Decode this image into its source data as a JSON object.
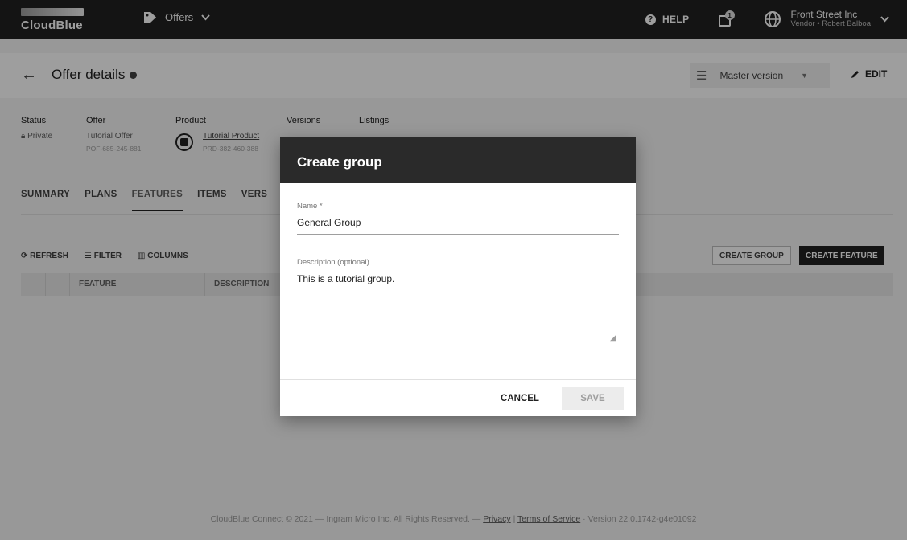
{
  "topbar": {
    "logo_text": "CloudBlue",
    "module_label": "Offers",
    "help_label": "HELP",
    "notif_count": "1",
    "account_name": "Front Street Inc",
    "account_sub": "Vendor • Robert Balboa"
  },
  "header": {
    "title": "Offer details",
    "version_label": "Master version",
    "edit_label": "EDIT"
  },
  "details": {
    "status": {
      "label": "Status",
      "value": "Private"
    },
    "offer": {
      "label": "Offer",
      "name": "Tutorial Offer",
      "id": "POF-685-245-881"
    },
    "product": {
      "label": "Product",
      "name": "Tutorial Product",
      "id": "PRD-382-460-388"
    },
    "versions": {
      "label": "Versions"
    },
    "listings": {
      "label": "Listings"
    }
  },
  "tabs": [
    "SUMMARY",
    "PLANS",
    "FEATURES",
    "ITEMS",
    "VERS"
  ],
  "toolbar": {
    "refresh": "REFRESH",
    "filter": "FILTER",
    "columns": "COLUMNS",
    "create_group": "CREATE GROUP",
    "create_feature": "CREATE FEATURE"
  },
  "table": {
    "columns": [
      "FEATURE",
      "DESCRIPTION"
    ]
  },
  "dialog": {
    "title": "Create group",
    "name_label": "Name *",
    "name_value": "General Group",
    "desc_label": "Description (optional)",
    "desc_value": "This is a tutorial group.",
    "cancel_label": "CANCEL",
    "save_label": "SAVE"
  },
  "footer": {
    "text_before": "CloudBlue Connect © 2021 — Ingram Micro Inc. All Rights Reserved. — ",
    "privacy": "Privacy",
    "separator": " | ",
    "terms": "Terms of Service",
    "version": " · Version 22.0.1742-g4e01092"
  }
}
